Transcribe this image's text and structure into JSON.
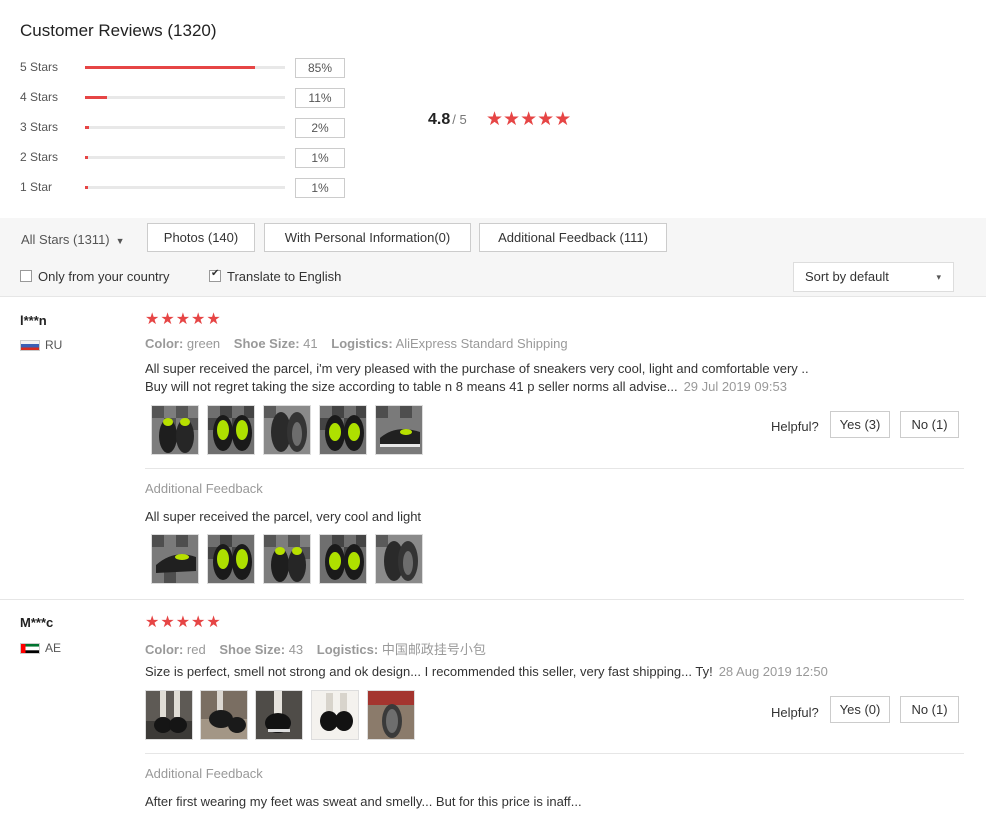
{
  "summary": {
    "title": "Customer Reviews (1320)",
    "rows": [
      {
        "label": "5 Stars",
        "pct": "85%",
        "fill": 0.85
      },
      {
        "label": "4 Stars",
        "pct": "11%",
        "fill": 0.11
      },
      {
        "label": "3 Stars",
        "pct": "2%",
        "fill": 0.02
      },
      {
        "label": "2 Stars",
        "pct": "1%",
        "fill": 0.01
      },
      {
        "label": "1 Star",
        "pct": "1%",
        "fill": 0.01
      }
    ],
    "rating": "4.8",
    "rating_of": "/ 5",
    "rating_stars": 5
  },
  "filters": {
    "all_stars": "All Stars (1311)",
    "photos": "Photos (140)",
    "personal": "With Personal Information(0)",
    "additional": "Additional Feedback (111)",
    "only_country": "Only from your country",
    "only_country_checked": false,
    "translate": "Translate to English",
    "translate_checked": true,
    "sort": "Sort by default"
  },
  "labels": {
    "color": "Color:",
    "shoe_size": "Shoe Size:",
    "logistics": "Logistics:",
    "helpful": "Helpful?",
    "additional_feedback": "Additional Feedback"
  },
  "reviews": [
    {
      "user": "l***n",
      "country": "RU",
      "stars": 5,
      "color": "green",
      "shoe_size": "41",
      "logistics": "AliExpress Standard Shipping",
      "text_line1": "All super received the parcel, i'm very pleased with the purchase of sneakers very cool, light and comfortable very ..",
      "text_line2": "Buy will not regret taking the size according to table n 8 means 41 p seller norms all advise...",
      "date": "29 Jul 2019 09:53",
      "yes": "Yes (3)",
      "no": "No (1)",
      "additional_text": "All super received the parcel, very cool and light"
    },
    {
      "user": "M***c",
      "country": "AE",
      "stars": 5,
      "color": "red",
      "shoe_size": "43",
      "logistics": "中国邮政挂号小包",
      "text_line1": "Size is perfect, smell not strong and ok design... I recommended this seller, very fast shipping... Ty!",
      "date": "28 Aug 2019 12:50",
      "yes": "Yes (0)",
      "no": "No (1)",
      "additional_text": "After first wearing my feet was sweat and smelly... But for this price is inaff..."
    }
  ]
}
